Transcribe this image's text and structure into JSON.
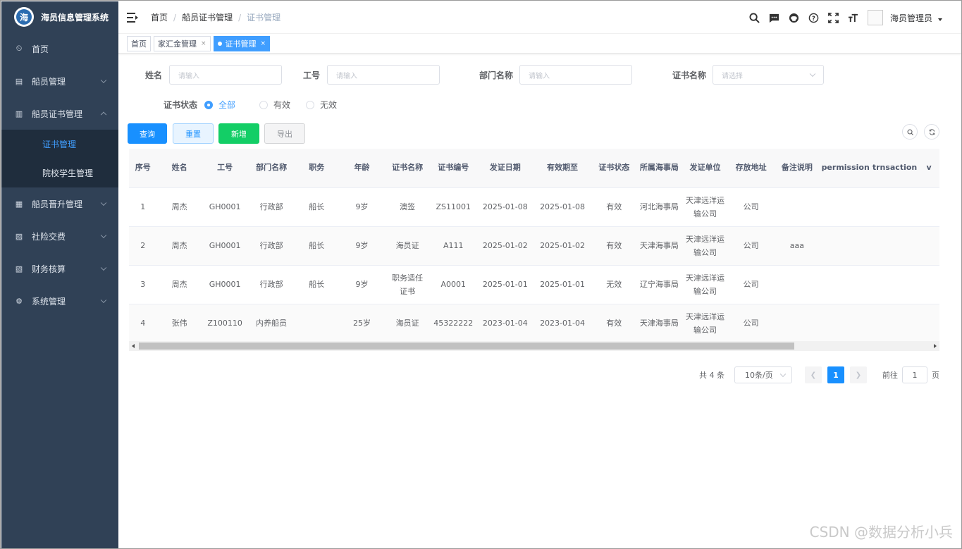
{
  "app": {
    "title": "海员信息管理系统",
    "logo_glyph": "海"
  },
  "sidebar": {
    "items": [
      {
        "label": "首页",
        "icon": "dashboard-icon",
        "glyph": "⏲"
      },
      {
        "label": "船员管理",
        "icon": "document-icon",
        "glyph": "▤"
      },
      {
        "label": "船员证书管理",
        "icon": "certificate-icon",
        "glyph": "▥",
        "expanded": true
      },
      {
        "label": "船员晋升管理",
        "icon": "promotion-icon",
        "glyph": "▦"
      },
      {
        "label": "社险交费",
        "icon": "calendar-icon",
        "glyph": "▨"
      },
      {
        "label": "财务核算",
        "icon": "finance-icon",
        "glyph": "▧"
      },
      {
        "label": "系统管理",
        "icon": "gear-icon",
        "glyph": "⚙"
      }
    ],
    "submenu": [
      {
        "label": "证书管理",
        "active": true
      },
      {
        "label": "院校学生管理",
        "active": false
      }
    ]
  },
  "navbar": {
    "breadcrumb": [
      "首页",
      "船员证书管理",
      "证书管理"
    ],
    "user_name": "海员管理员",
    "icons": [
      "search-icon",
      "message-icon",
      "github-icon",
      "help-icon",
      "fullscreen-icon",
      "font-size-icon"
    ]
  },
  "tags": [
    {
      "label": "首页",
      "closable": false,
      "active": false
    },
    {
      "label": "家汇金管理",
      "closable": true,
      "active": false
    },
    {
      "label": "证书管理",
      "closable": true,
      "active": true
    }
  ],
  "filters": {
    "name_label": "姓名",
    "name_placeholder": "请输入",
    "job_label": "工号",
    "job_placeholder": "请输入",
    "dept_label": "部门名称",
    "dept_placeholder": "请输入",
    "cert_label": "证书名称",
    "cert_placeholder": "请选择",
    "status_label": "证书状态",
    "status_options": [
      "全部",
      "有效",
      "无效"
    ],
    "status_selected": "全部"
  },
  "buttons": {
    "query": "查询",
    "reset": "重置",
    "add": "新增",
    "export": "导出"
  },
  "table": {
    "columns": [
      "序号",
      "姓名",
      "工号",
      "部门名称",
      "职务",
      "年龄",
      "证书名称",
      "证书编号",
      "发证日期",
      "有效期至",
      "证书状态",
      "所属海事局",
      "发证单位",
      "存放地址",
      "备注说明",
      "permission",
      "trnsaction",
      "v"
    ],
    "rows": [
      [
        "1",
        "周杰",
        "GH0001",
        "行政部",
        "船长",
        "9岁",
        "澳签",
        "ZS11001",
        "2025-01-08",
        "2025-01-08",
        "有效",
        "河北海事局",
        "天津远洋运输公司",
        "公司",
        "",
        "",
        "",
        ""
      ],
      [
        "2",
        "周杰",
        "GH0001",
        "行政部",
        "船长",
        "9岁",
        "海员证",
        "A111",
        "2025-01-02",
        "2025-01-02",
        "有效",
        "天津海事局",
        "天津远洋运输公司",
        "公司",
        "aaa",
        "",
        "",
        ""
      ],
      [
        "3",
        "周杰",
        "GH0001",
        "行政部",
        "船长",
        "9岁",
        "职务适任证书",
        "A0001",
        "2025-01-01",
        "2025-01-01",
        "无效",
        "辽宁海事局",
        "天津远洋运输公司",
        "公司",
        "",
        "",
        "",
        ""
      ],
      [
        "4",
        "张伟",
        "Z100110",
        "内养船员",
        "",
        "25岁",
        "海员证",
        "45322222",
        "2023-01-04",
        "2023-01-04",
        "有效",
        "天津海事局",
        "天津远洋运输公司",
        "公司",
        "",
        "",
        "",
        ""
      ]
    ]
  },
  "pagination": {
    "total": "共 4 条",
    "page_size": "10条/页",
    "current": "1",
    "goto_label": "前往",
    "goto_value": "1",
    "page_suffix": "页"
  },
  "watermark": "CSDN @数据分析小兵"
}
